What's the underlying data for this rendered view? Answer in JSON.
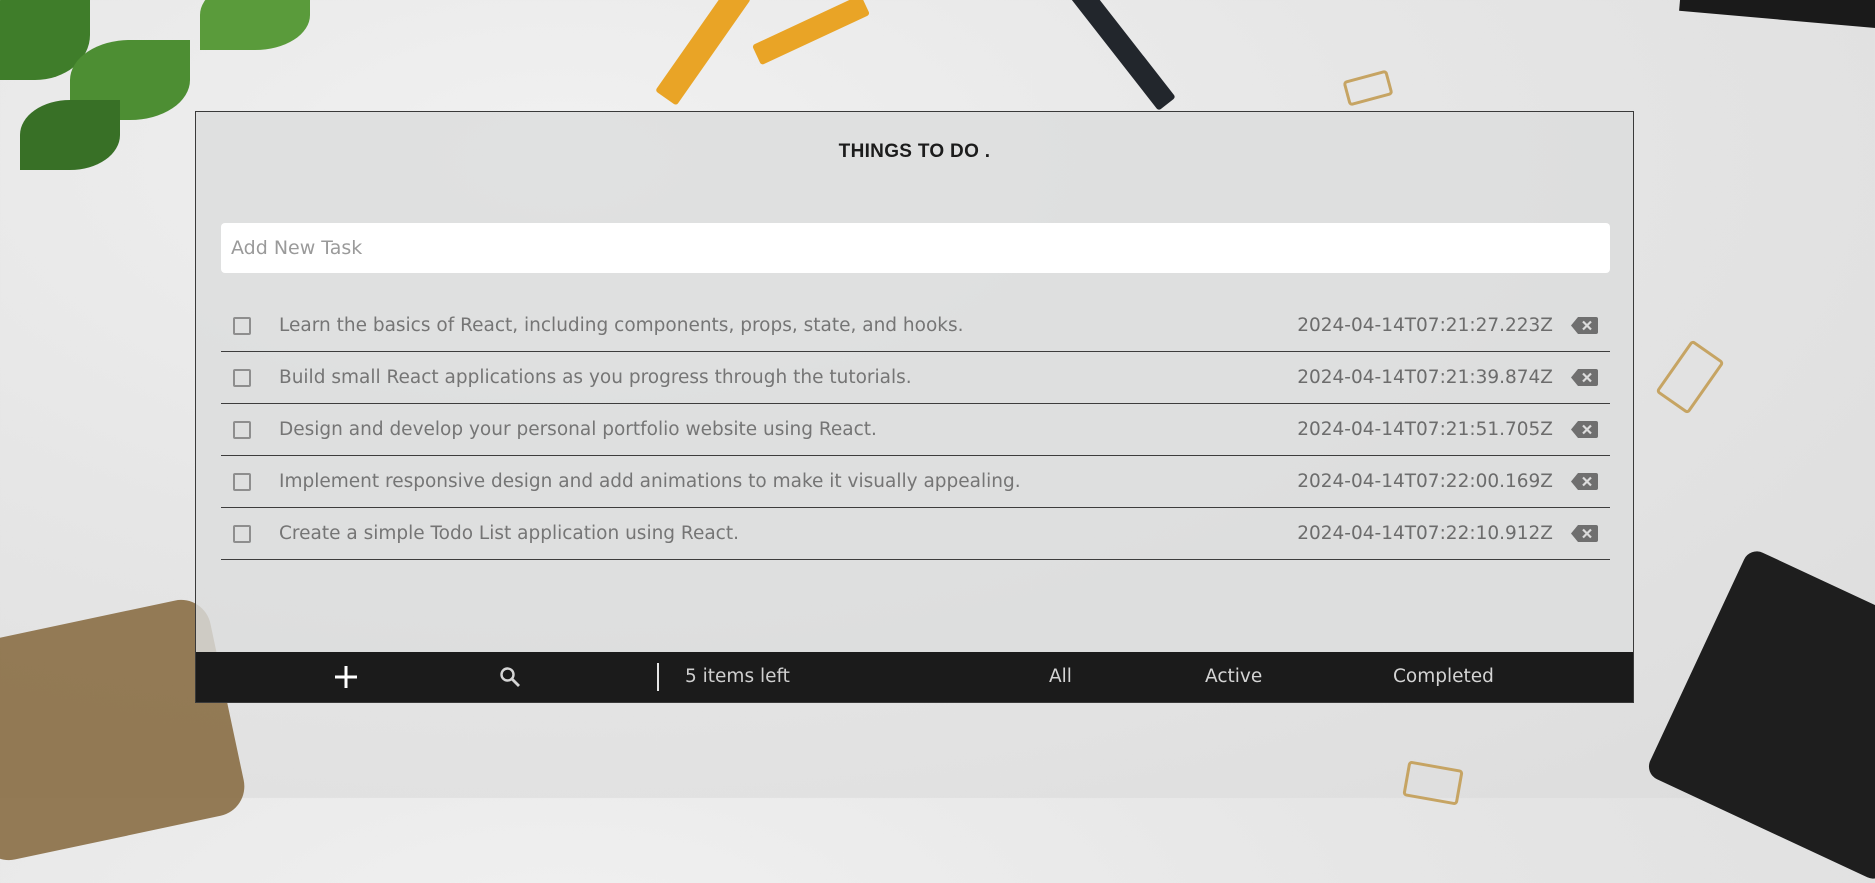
{
  "header": {
    "title": "THINGS TO DO ."
  },
  "new_task": {
    "placeholder": "Add New Task"
  },
  "todos": [
    {
      "text": "Learn the basics of React, including components, props, state, and hooks.",
      "created": "2024-04-14T07:21:27.223Z",
      "completed": false
    },
    {
      "text": "Build small React applications as you progress through the tutorials.",
      "created": "2024-04-14T07:21:39.874Z",
      "completed": false
    },
    {
      "text": "Design and develop your personal portfolio website using React.",
      "created": "2024-04-14T07:21:51.705Z",
      "completed": false
    },
    {
      "text": "Implement responsive design and add animations to make it visually appealing.",
      "created": "2024-04-14T07:22:00.169Z",
      "completed": false
    },
    {
      "text": "Create a simple Todo List application using React.",
      "created": "2024-04-14T07:22:10.912Z",
      "completed": false
    }
  ],
  "footer": {
    "items_left": "5 items left",
    "filters": {
      "all": "All",
      "active": "Active",
      "completed": "Completed"
    },
    "icons": {
      "add": "plus-icon",
      "search": "search-icon"
    }
  },
  "colors": {
    "footer_bg": "#1b1b1b",
    "panel_border": "#3a3a3a"
  }
}
